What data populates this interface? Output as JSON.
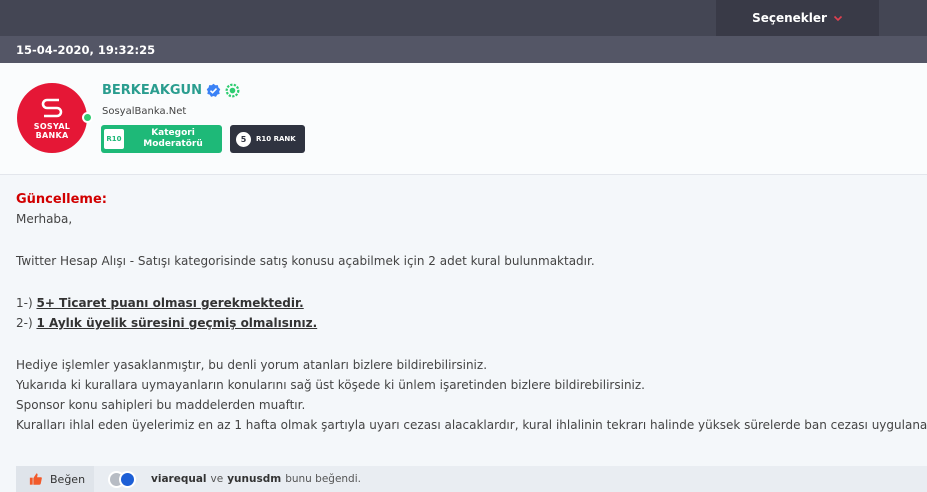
{
  "header": {
    "options_label": "Seçenekler"
  },
  "post": {
    "datetime": "15-04-2020, 19:32:25"
  },
  "user": {
    "avatar_line1": "SOSYAL",
    "avatar_line2": "BANKA",
    "name": "BERKEAKGUN",
    "subtitle": "SosyalBanka.Net",
    "rank_badge": {
      "icon_text": "R10",
      "line1": "Kategori",
      "line2": "Moderatörü",
      "color": "#1eb978"
    },
    "level_badge": {
      "level": "5",
      "label": "R10 RANK",
      "color": "#2f3340"
    }
  },
  "content": {
    "heading": "Güncelleme:",
    "greeting": "Merhaba,",
    "intro": "Twitter Hesap Alışı - Satışı kategorisinde satış konusu açabilmek için 2 adet kural bulunmaktadır.",
    "rules": [
      {
        "prefix": "1-) ",
        "text": "5+ Ticaret puanı olması gerekmektedir."
      },
      {
        "prefix": "2-) ",
        "text": "1 Aylık üyelik süresini geçmiş olmalısınız."
      }
    ],
    "notes": [
      "Hediye işlemler yasaklanmıştır, bu denli yorum atanları bizlere bildirebilirsiniz.",
      "Yukarıda ki kurallara uymayanların konularını sağ üst köşede ki ünlem işaretinden bizlere bildirebilirsiniz.",
      "Sponsor konu sahipleri bu maddelerden muaftır.",
      "Kuralları ihlal eden üyelerimiz en az 1 hafta olmak şartıyla uyarı cezası alacaklardır, kural ihlalinin tekrarı halinde yüksek sürelerde ban cezası uygulanacaktır."
    ]
  },
  "footer": {
    "like_label": "Beğen",
    "liker1": "viarequal",
    "joiner": "ve",
    "liker2": "yunusdm",
    "suffix": "bunu beğendi."
  },
  "colors": {
    "topbar": "#444654",
    "datebar": "#545666",
    "heading": "#d10000",
    "username": "#2a9d8f",
    "avatar": "#e51736"
  },
  "icons": [
    "chevron-down-icon",
    "verified-icon",
    "gear-badge-icon",
    "thumbs-up-icon"
  ]
}
